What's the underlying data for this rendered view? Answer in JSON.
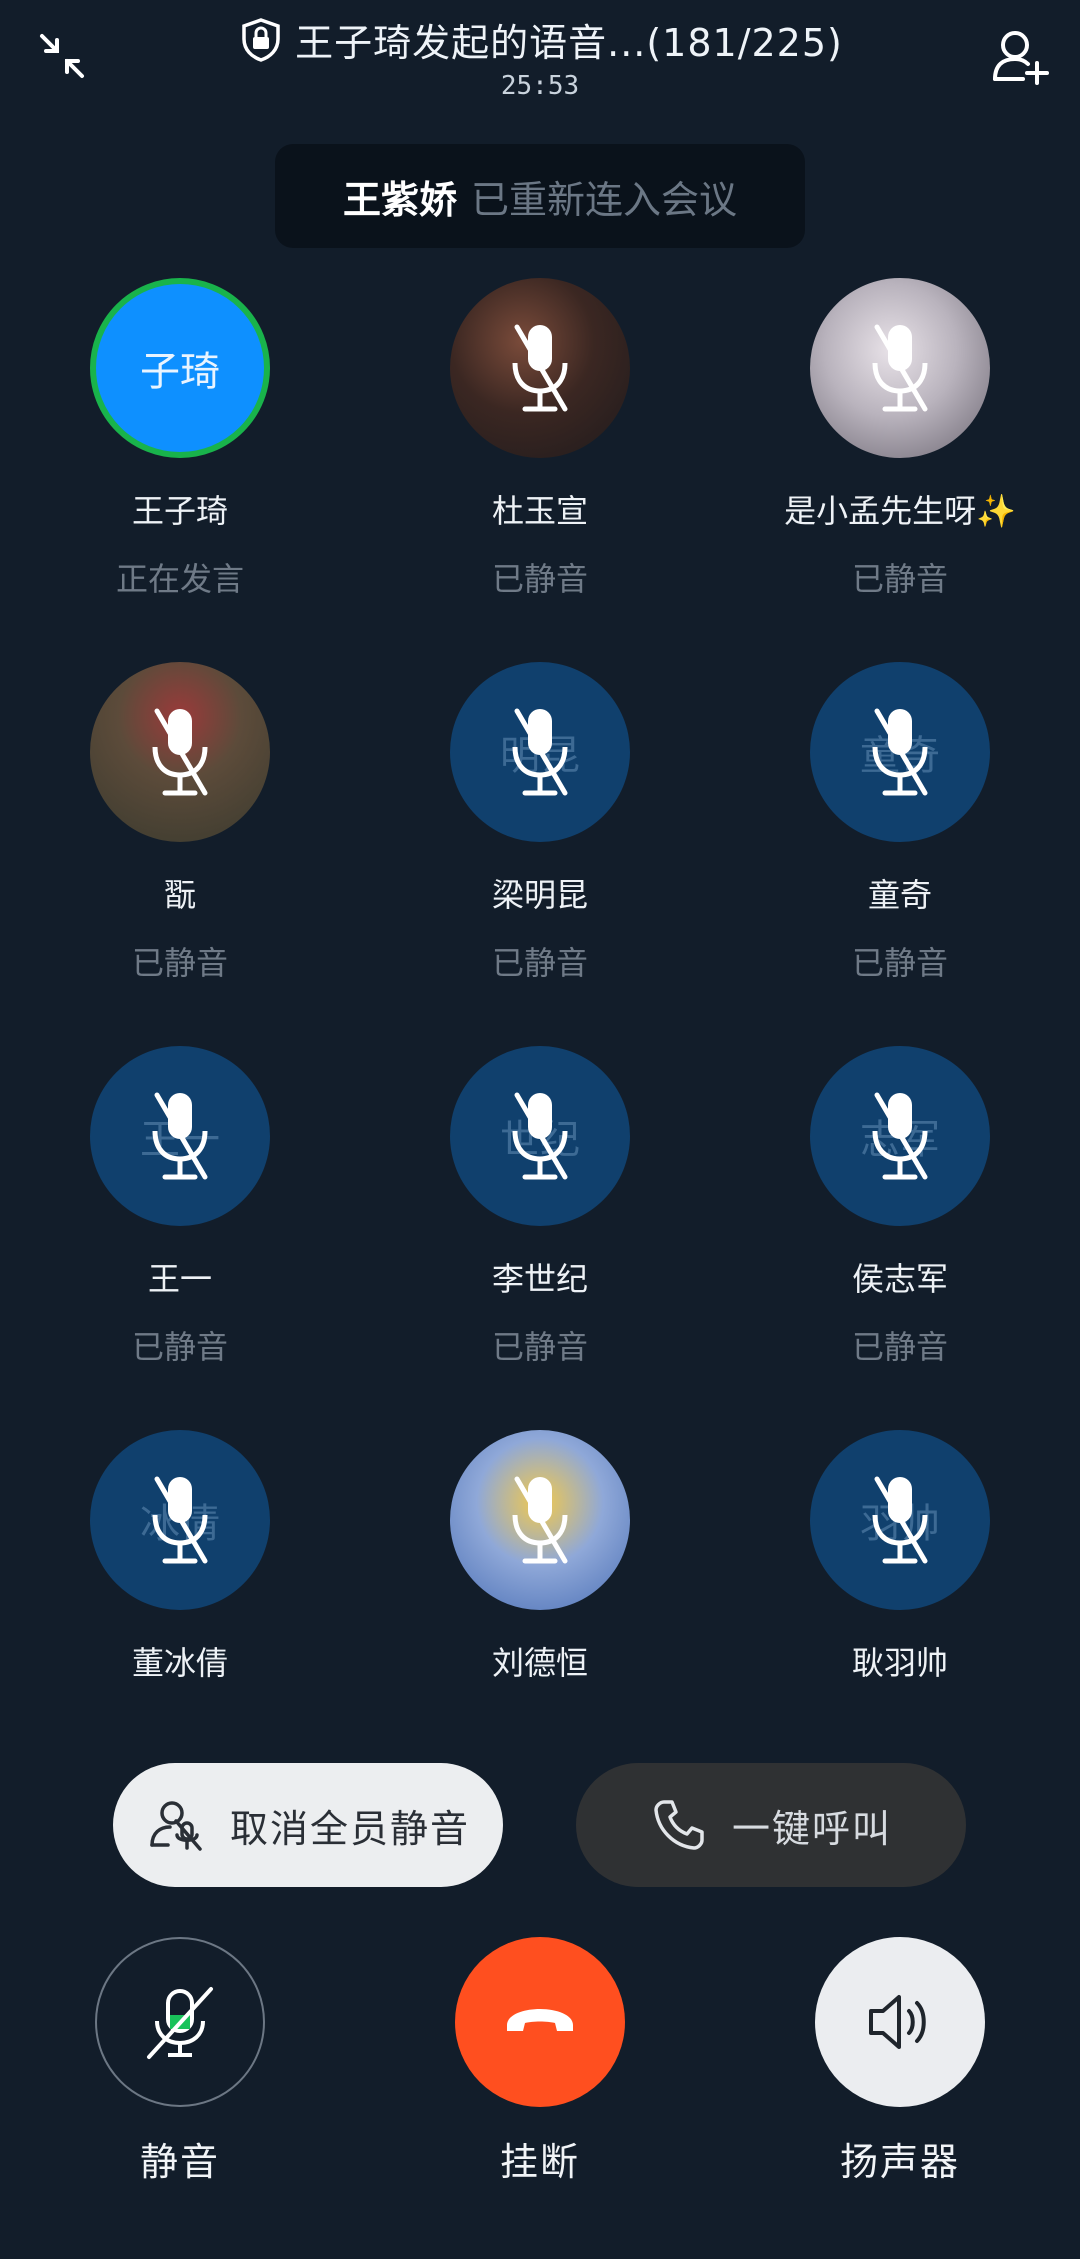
{
  "header": {
    "title": "王子琦发起的语音...(181/225)",
    "timer": "25:53"
  },
  "toast": {
    "name": "王紫娇",
    "message": "已重新连入会议"
  },
  "participants": [
    {
      "name": "王子琦",
      "status": "正在发言",
      "avatar_text": "子琦",
      "avatar_style": "speaking",
      "muted": false
    },
    {
      "name": "杜玉宣",
      "status": "已静音",
      "avatar_text": "",
      "avatar_style": "photo1",
      "muted": true
    },
    {
      "name": "是小孟先生呀✨",
      "status": "已静音",
      "avatar_text": "",
      "avatar_style": "photo2",
      "muted": true
    },
    {
      "name": "翫",
      "status": "已静音",
      "avatar_text": "",
      "avatar_style": "photo3",
      "muted": true
    },
    {
      "name": "梁明昆",
      "status": "已静音",
      "avatar_text": "明昆",
      "avatar_style": "blue",
      "muted": true
    },
    {
      "name": "童奇",
      "status": "已静音",
      "avatar_text": "童奇",
      "avatar_style": "blue",
      "muted": true
    },
    {
      "name": "王一",
      "status": "已静音",
      "avatar_text": "王一",
      "avatar_style": "blue",
      "muted": true
    },
    {
      "name": "李世纪",
      "status": "已静音",
      "avatar_text": "世纪",
      "avatar_style": "blue",
      "muted": true
    },
    {
      "name": "侯志军",
      "status": "已静音",
      "avatar_text": "志军",
      "avatar_style": "blue",
      "muted": true
    },
    {
      "name": "董冰倩",
      "status": "",
      "avatar_text": "冰倩",
      "avatar_style": "blue",
      "muted": true
    },
    {
      "name": "刘德恒",
      "status": "",
      "avatar_text": "",
      "avatar_style": "photo4",
      "muted": true
    },
    {
      "name": "耿羽帅",
      "status": "",
      "avatar_text": "羽帅",
      "avatar_style": "blue",
      "muted": true
    }
  ],
  "actions": {
    "unmute_all_label": "取消全员静音",
    "call_all_label": "一键呼叫"
  },
  "controls": {
    "mute_label": "静音",
    "hangup_label": "挂断",
    "speaker_label": "扬声器"
  },
  "icons": {
    "shrink": "shrink-arrows-icon",
    "lock": "shield-lock-icon",
    "add_person": "add-person-icon",
    "muted_mic": "mic-off-icon",
    "phone": "phone-icon",
    "hangup": "hangup-icon",
    "speaker": "speaker-icon"
  },
  "colors": {
    "background": "#121d2a",
    "speaking_avatar": "#0e90ff",
    "speaking_ring": "#19b34b",
    "muted_avatar": "#10406d",
    "hangup": "#ff4f1f",
    "mute_indicator": "#19c25a"
  }
}
